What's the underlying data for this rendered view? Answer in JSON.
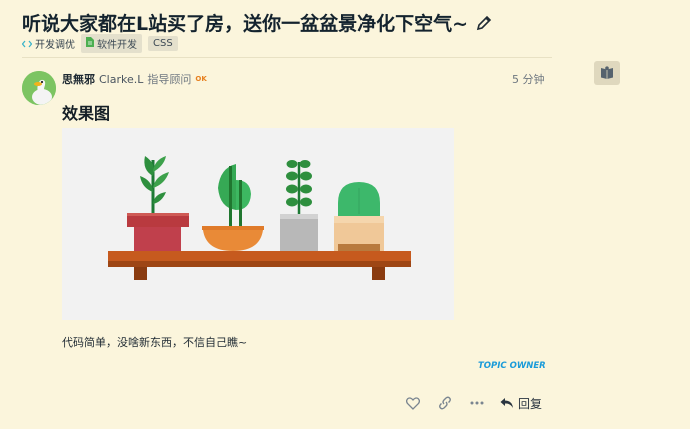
{
  "topic": {
    "title": "听说大家都在L站买了房，送你一盆盆景净化下空气~",
    "category": "开发调优",
    "tags": [
      "软件开发",
      "CSS"
    ]
  },
  "post": {
    "username": "思無邪",
    "fullname": "Clarke.L",
    "user_title": "指导顾问",
    "badge": "OK",
    "time": "5 分钟",
    "heading": "效果图",
    "body": "代码简单，没啥新东西，不信自己瞧~",
    "owner_badge": "TOPIC OWNER"
  },
  "actions": {
    "reply_label": "回复"
  },
  "icons": {
    "edit": "pencil-icon",
    "category": "code-icon",
    "tag": "file-icon",
    "side": "map-book-icon",
    "like": "heart-icon",
    "link": "link-icon",
    "more": "more-dots-icon",
    "reply": "reply-arrow-icon"
  },
  "colors": {
    "background": "#fbf5dc",
    "owner_badge": "#1a9bd9",
    "ok_badge": "#e7801f",
    "shelf": "#c65a1e"
  }
}
